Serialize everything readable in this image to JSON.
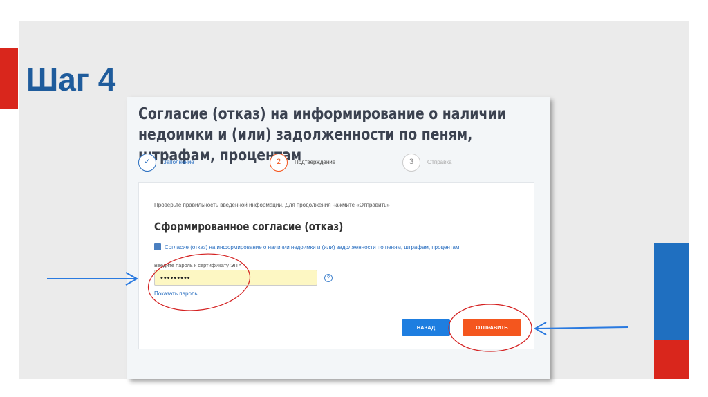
{
  "slide": {
    "title": "Шаг 4"
  },
  "page": {
    "title": "Согласие (отказ) на информирование о наличии недоимки и (или) задолженности по пеням, штрафам, процентам"
  },
  "stepper": [
    {
      "num": "✓",
      "label": "Заполнение"
    },
    {
      "num": "2",
      "label": "Подтверждение"
    },
    {
      "num": "3",
      "label": "Отправка"
    }
  ],
  "card": {
    "hint": "Проверьте правильность введенной информации. Для продолжения нажмите «Отправить»",
    "heading": "Сформированное согласие (отказ)",
    "document_link": "Согласие (отказ) на информирование о наличии недоимки и (или) задолженности по пеням, штрафам, процентам",
    "password_label": "Введите пароль к сертификату ЭП *",
    "password_value": "•••••••••",
    "help": "?",
    "show_password": "Показать пароль",
    "back_label": "НАЗАД",
    "send_label": "ОТПРАВИТЬ"
  },
  "colors": {
    "brand_blue": "#1f5c9c",
    "accent_red": "#d9261c",
    "send": "#f4561e",
    "back": "#1e7ee0"
  }
}
